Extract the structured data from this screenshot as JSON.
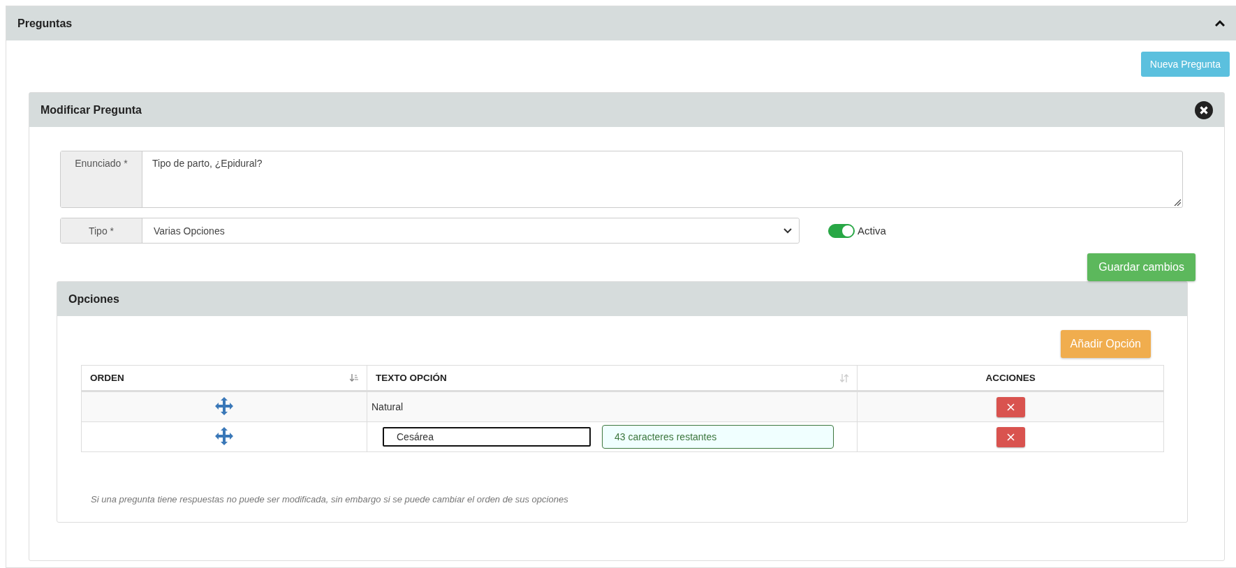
{
  "section": {
    "title": "Preguntas",
    "expanded": true,
    "new_button": "Nueva Pregunta"
  },
  "editor": {
    "title": "Modificar Pregunta",
    "statement": {
      "label": "Enunciado *",
      "value": "Tipo de parto, ¿Epidural?"
    },
    "type": {
      "label": "Tipo *",
      "value": "Varias Opciones"
    },
    "active": {
      "label": "Activa",
      "on": true
    },
    "save_button": "Guardar cambios",
    "options": {
      "title": "Opciones",
      "add_button": "Añadir Opción",
      "columns": [
        "ORDEN",
        "TEXTO OPCIÓN",
        "ACCIONES"
      ],
      "rows": [
        {
          "kind": "static",
          "text": "Natural"
        },
        {
          "kind": "edit",
          "text": "Cesárea",
          "counter": "43 caracteres restantes"
        }
      ],
      "note": "Si una pregunta tiene respuestas no puede ser modificada, sin embargo si se puede cambiar el orden de sus opciones"
    }
  }
}
